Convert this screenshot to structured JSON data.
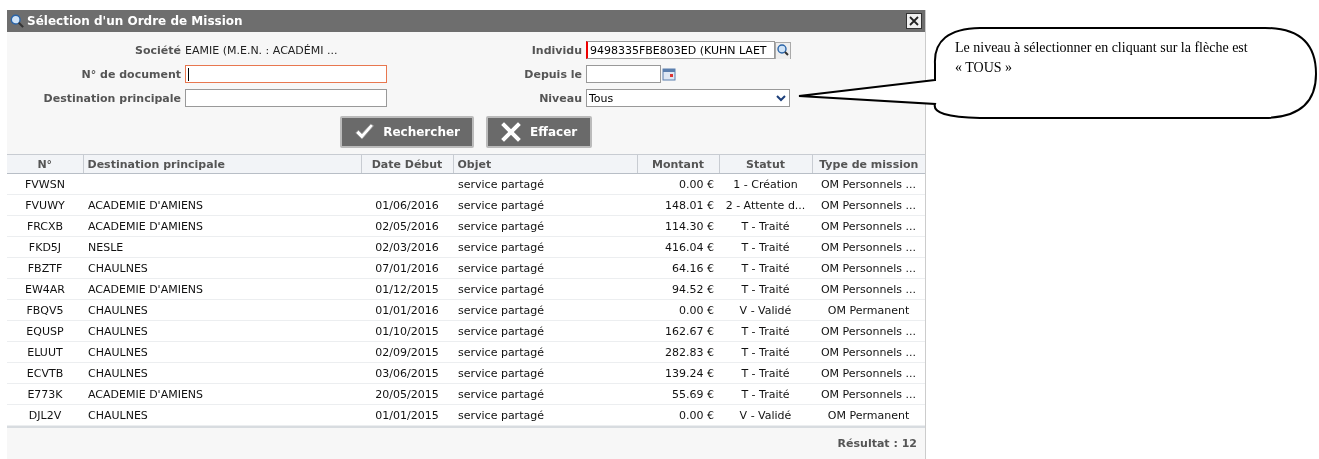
{
  "window": {
    "title": "Sélection d'un Ordre de Mission"
  },
  "form": {
    "left": [
      {
        "kind": "text",
        "label": "Société",
        "value": "EAMIE (M.E.N. : ACADÉMI ..."
      },
      {
        "kind": "input",
        "label": "N° de document",
        "focused": true
      },
      {
        "kind": "input",
        "label": "Destination principale",
        "focused": false
      }
    ],
    "right": [
      {
        "kind": "lookup",
        "label": "Individu",
        "value": "9498335FBE803ED (KUHN LAET"
      },
      {
        "kind": "date",
        "label": "Depuis le"
      },
      {
        "kind": "select",
        "label": "Niveau",
        "value": "Tous"
      }
    ]
  },
  "buttons": [
    {
      "kind": "check",
      "label": "Rechercher"
    },
    {
      "kind": "cross",
      "label": "Effacer"
    }
  ],
  "table": {
    "columns": [
      "N°",
      "Destination principale",
      "Date Début",
      "Objet",
      "Montant",
      "Statut",
      "Type de mission"
    ],
    "rows": [
      [
        "FVWSN",
        "",
        "",
        "service partagé",
        "0.00 €",
        "1 - Création",
        "OM Personnels ..."
      ],
      [
        "FVUWY",
        "ACADEMIE D'AMIENS",
        "01/06/2016",
        "service partagé",
        "148.01 €",
        "2 - Attente d...",
        "OM Personnels ..."
      ],
      [
        "FRCXB",
        "ACADEMIE D'AMIENS",
        "02/05/2016",
        "service partagé",
        "114.30 €",
        "T - Traité",
        "OM Personnels ..."
      ],
      [
        "FKD5J",
        "NESLE",
        "02/03/2016",
        "service partagé",
        "416.04 €",
        "T - Traité",
        "OM Personnels ..."
      ],
      [
        "FBZTF",
        "CHAULNES",
        "07/01/2016",
        "service partagé",
        "64.16 €",
        "T - Traité",
        "OM Personnels ..."
      ],
      [
        "EW4AR",
        "ACADEMIE D'AMIENS",
        "01/12/2015",
        "service partagé",
        "94.52 €",
        "T - Traité",
        "OM Personnels ..."
      ],
      [
        "FBQV5",
        "CHAULNES",
        "01/01/2016",
        "service partagé",
        "0.00 €",
        "V - Validé",
        "OM Permanent"
      ],
      [
        "EQUSP",
        "CHAULNES",
        "01/10/2015",
        "service partagé",
        "162.67 €",
        "T - Traité",
        "OM Personnels ..."
      ],
      [
        "ELUUT",
        "CHAULNES",
        "02/09/2015",
        "service partagé",
        "282.83 €",
        "T - Traité",
        "OM Personnels ..."
      ],
      [
        "ECVTB",
        "CHAULNES",
        "03/06/2015",
        "service partagé",
        "139.24 €",
        "T - Traité",
        "OM Personnels ..."
      ],
      [
        "E773K",
        "ACADEMIE D'AMIENS",
        "20/05/2015",
        "service partagé",
        "55.69 €",
        "T - Traité",
        "OM Personnels ..."
      ],
      [
        "DJL2V",
        "CHAULNES",
        "01/01/2015",
        "service partagé",
        "0.00 €",
        "V - Validé",
        "OM Permanent"
      ]
    ],
    "result": "Résultat : 12"
  },
  "callout": {
    "text": "Le niveau à sélectionner en cliquant sur la flèche est « TOUS »"
  }
}
